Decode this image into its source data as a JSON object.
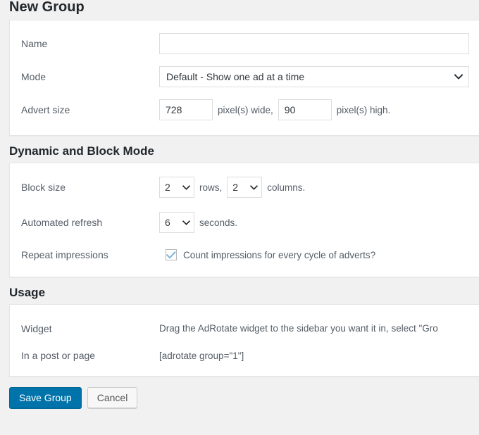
{
  "page": {
    "title": "New Group",
    "accent_color": "#0073aa",
    "background_color": "#f1f1f1"
  },
  "general": {
    "rows": {
      "name": {
        "label": "Name",
        "value": "",
        "placeholder": ""
      },
      "mode": {
        "label": "Mode",
        "selected": "Default - Show one ad at a time"
      },
      "advert_size": {
        "label": "Advert size",
        "width_value": "728",
        "width_unit": "pixel(s) wide,",
        "height_value": "90",
        "height_unit": "pixel(s) high."
      }
    }
  },
  "dynamic_block": {
    "heading": "Dynamic and Block Mode",
    "rows": {
      "block_size": {
        "label": "Block size",
        "rows_selected": "2",
        "rows_unit": "rows,",
        "columns_selected": "2",
        "columns_unit": "columns."
      },
      "automated_refresh": {
        "label": "Automated refresh",
        "selected": "6",
        "unit": "seconds."
      },
      "repeat_impressions": {
        "label": "Repeat impressions",
        "checked": true,
        "checkbox_label": "Count impressions for every cycle of adverts?"
      }
    }
  },
  "usage": {
    "heading": "Usage",
    "rows": [
      {
        "label": "Widget",
        "value": "Drag the AdRotate widget to the sidebar you want it in, select \"Gro"
      },
      {
        "label": "In a post or page",
        "value": "[adrotate group=\"1\"]"
      }
    ]
  },
  "actions": {
    "save_label": "Save Group",
    "cancel_label": "Cancel"
  }
}
